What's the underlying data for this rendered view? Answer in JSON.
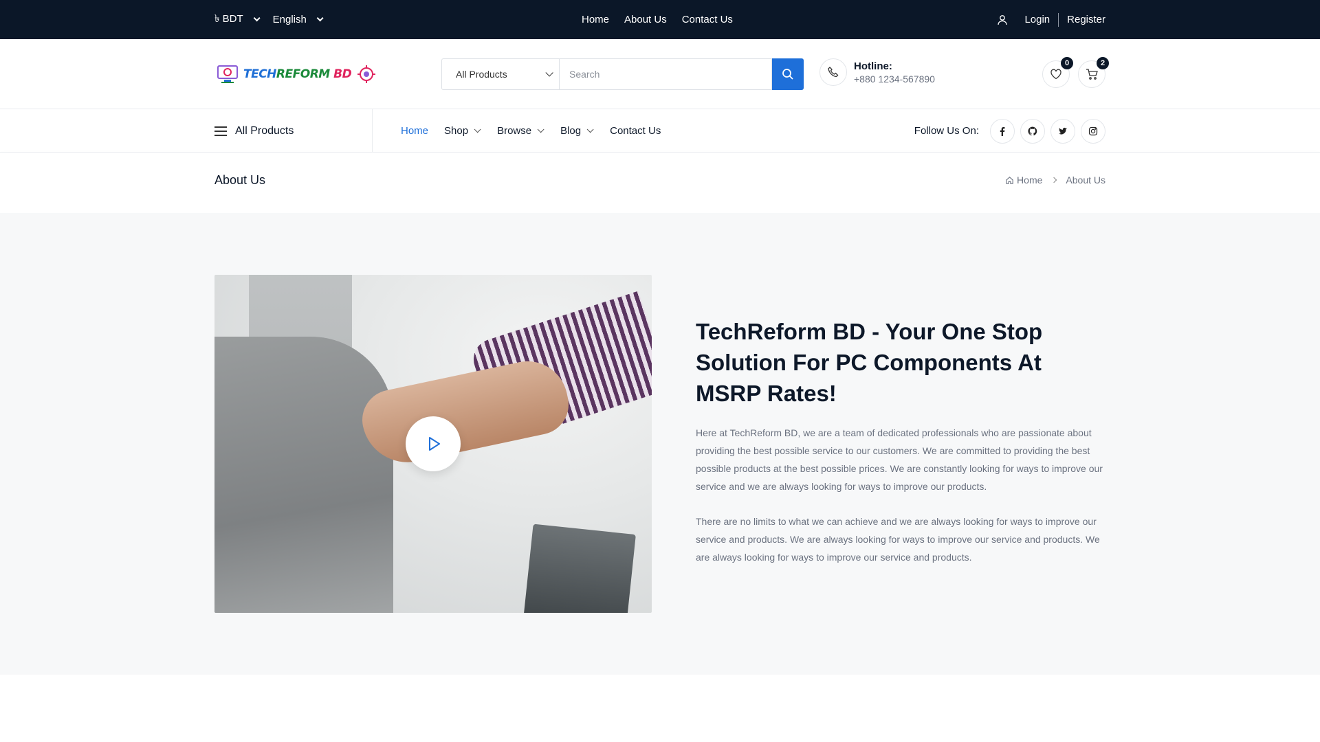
{
  "topbar": {
    "currency": "৳ BDT",
    "language": "English",
    "links": [
      "Home",
      "About Us",
      "Contact Us"
    ],
    "login": "Login",
    "register": "Register"
  },
  "header": {
    "logo": {
      "part1": "TECH",
      "part2": "REFORM",
      "part3": " BD"
    },
    "category": "All Products",
    "search_placeholder": "Search",
    "hotline_label": "Hotline:",
    "hotline_number": "+880 1234-567890",
    "wishlist_count": "0",
    "cart_count": "2"
  },
  "nav": {
    "all_products": "All Products",
    "items": [
      "Home",
      "Shop",
      "Browse",
      "Blog",
      "Contact Us"
    ],
    "follow_label": "Follow Us On:",
    "social_icons": [
      "facebook-icon",
      "github-icon",
      "twitter-icon",
      "instagram-icon"
    ]
  },
  "page": {
    "title": "About Us",
    "breadcrumb": [
      "Home",
      "About Us"
    ]
  },
  "about": {
    "heading": "TechReform BD - Your One Stop Solution For PC Components At MSRP Rates!",
    "para1": "Here at TechReform BD, we are a team of dedicated professionals who are passionate about providing the best possible service to our customers. We are committed to providing the best possible products at the best possible prices. We are constantly looking for ways to improve our service and we are always looking for ways to improve our products.",
    "para2": "There are no limits to what we can achieve and we are always looking for ways to improve our service and products. We are always looking for ways to improve our service and products. We are always looking for ways to improve our service and products."
  },
  "colors": {
    "topbar_bg": "#0b1728",
    "accent": "#1e6fd9",
    "section_bg": "#f7f8f9"
  }
}
